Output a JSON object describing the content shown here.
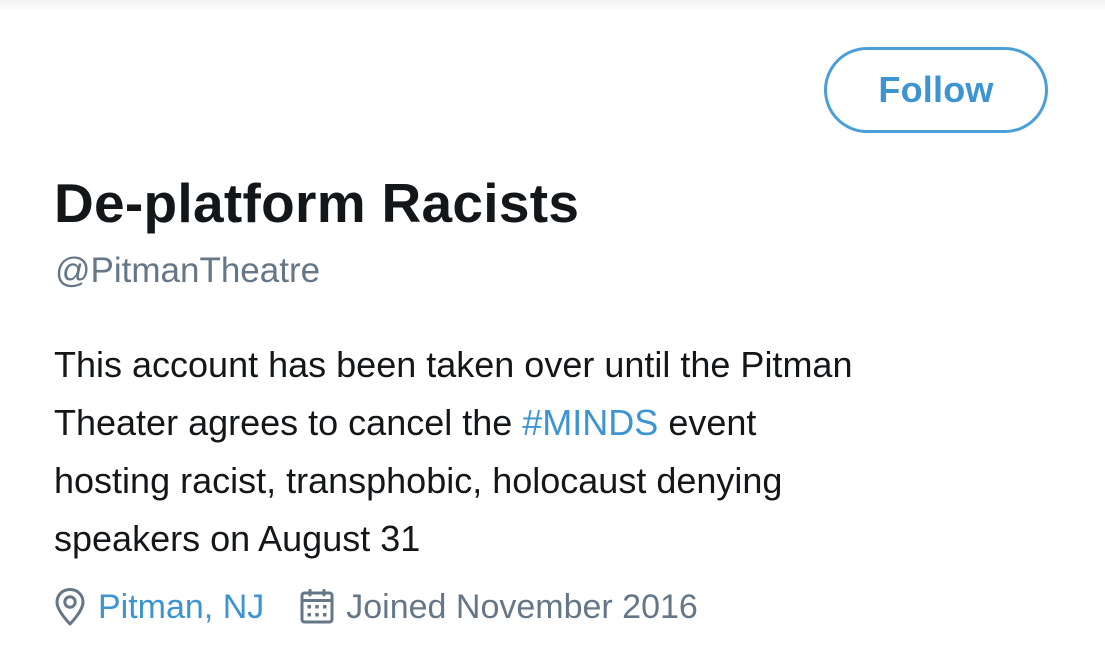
{
  "profile": {
    "follow_label": "Follow",
    "display_name": "De-platform Racists",
    "handle": "@PitmanTheatre",
    "bio": {
      "line1": "This account has been taken over until the Pitman",
      "line2_before": "Theater agrees to cancel the ",
      "line2_hashtag": "#MINDS",
      "line2_after": " event",
      "line3": "hosting racist, transphobic, holocaust denying",
      "line4": "speakers on August 31"
    },
    "location": "Pitman, NJ",
    "joined": "Joined November 2016"
  },
  "icons": {
    "location": "location-pin-icon",
    "joined": "calendar-icon"
  },
  "colors": {
    "accent": "#3d94d0",
    "text": "#14171a",
    "secondary_text": "#657786"
  }
}
